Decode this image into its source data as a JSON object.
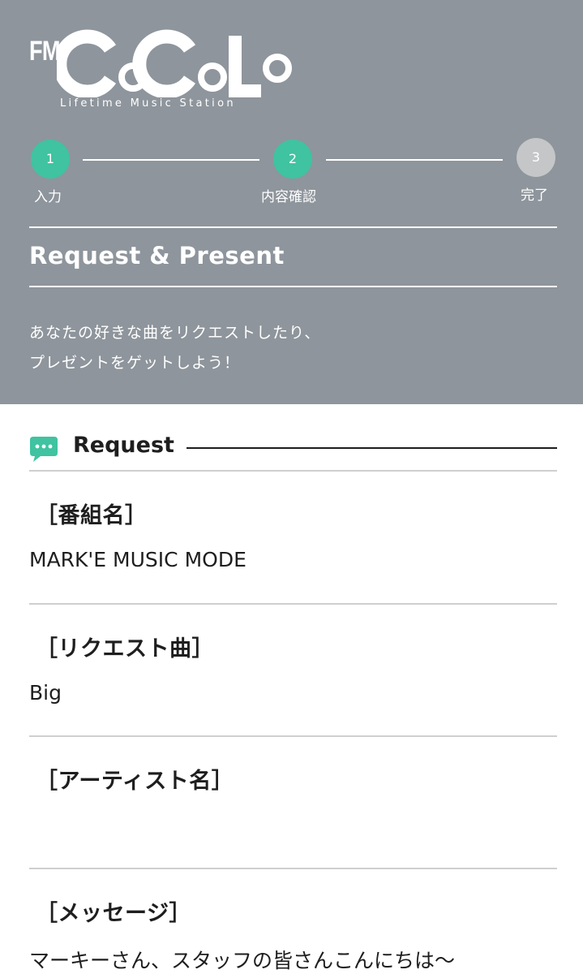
{
  "logo": {
    "prefix": "FM",
    "name": "CoCoLo",
    "tagline": "Lifetime Music Station"
  },
  "steps": [
    {
      "number": "1",
      "label": "入力",
      "state": "done"
    },
    {
      "number": "2",
      "label": "内容確認",
      "state": "current"
    },
    {
      "number": "3",
      "label": "完了",
      "state": "pending"
    }
  ],
  "header": {
    "title": "Request & Present",
    "description_line1": "あなたの好きな曲をリクエストしたり、",
    "description_line2": "プレゼントをゲットしよう！"
  },
  "section": {
    "title": "Request",
    "icon": "chat-bubble-icon"
  },
  "fields": [
    {
      "label": "［番組名］",
      "value": "MARK'E MUSIC MODE"
    },
    {
      "label": "［リクエスト曲］",
      "value": "Big"
    },
    {
      "label": "［アーティスト名］",
      "value": ""
    },
    {
      "label": "［メッセージ］",
      "value": "マーキーさん、スタッフの皆さんこんにちは〜"
    }
  ],
  "colors": {
    "header_bg": "#8e959c",
    "accent": "#3fc3a0",
    "pending": "#c4c6c8",
    "text": "#1e1e1e"
  }
}
